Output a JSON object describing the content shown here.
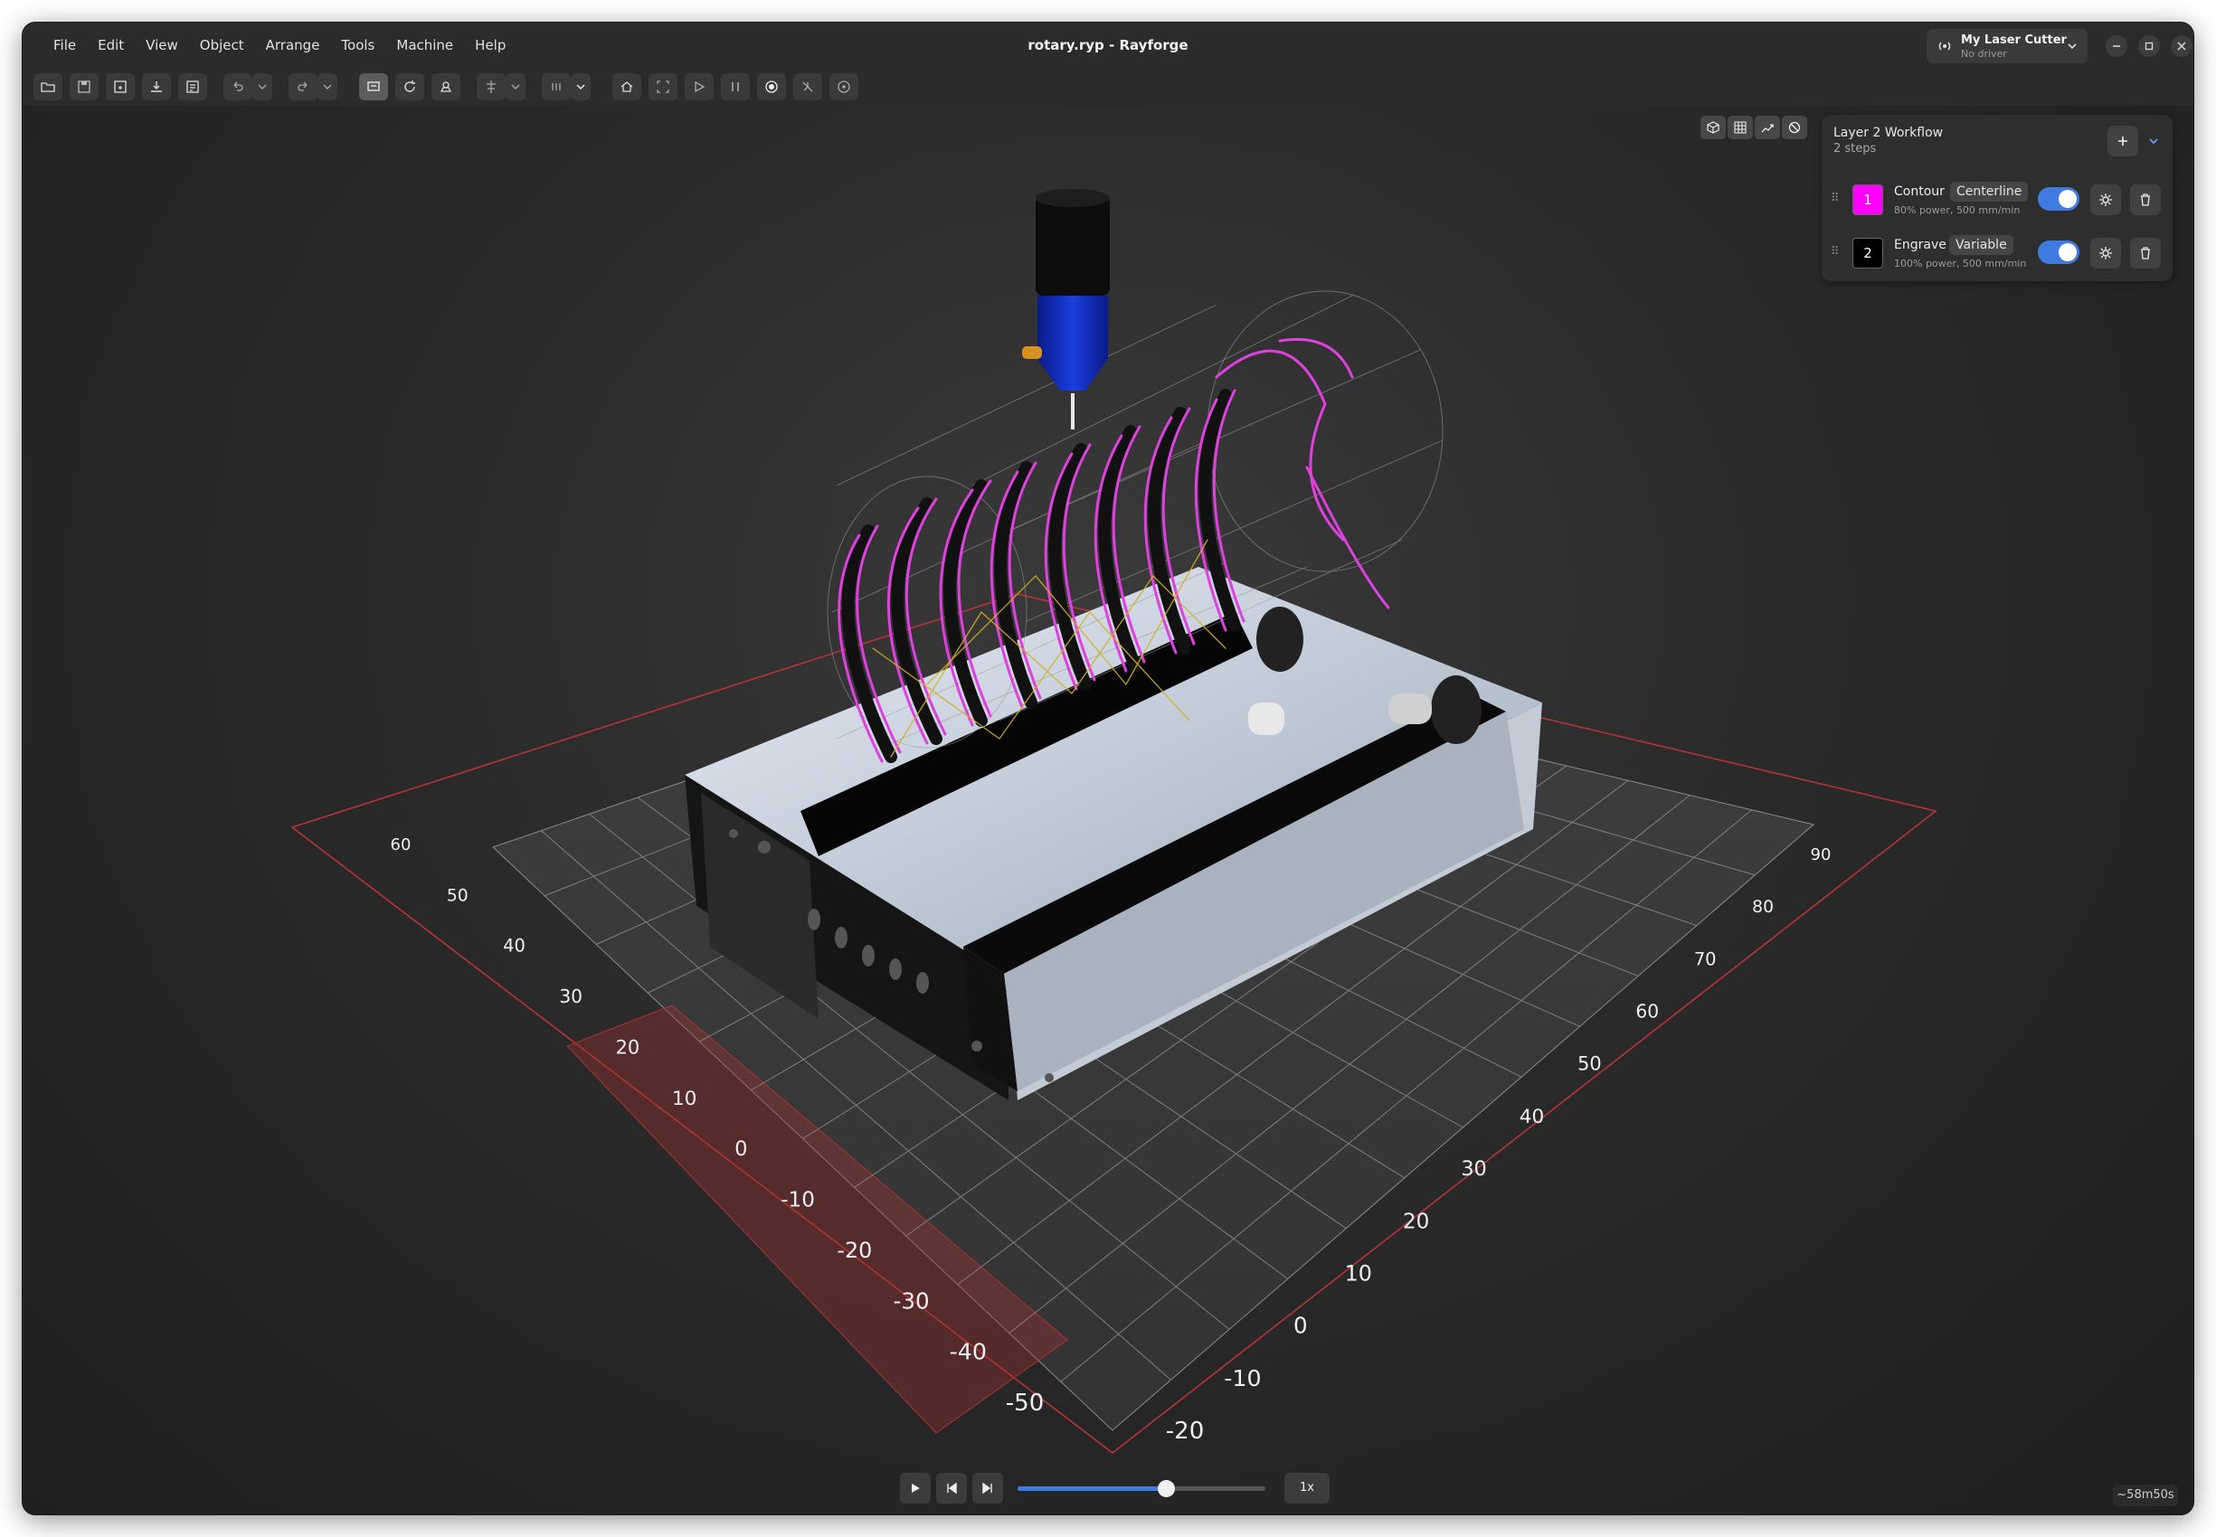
{
  "window": {
    "title": "rotary.ryp - Rayforge"
  },
  "menu": [
    "File",
    "Edit",
    "View",
    "Object",
    "Arrange",
    "Tools",
    "Machine",
    "Help"
  ],
  "machine": {
    "name": "My Laser Cutter",
    "status": "No driver"
  },
  "workflow": {
    "title": "Layer 2 Workflow",
    "subtitle": "2 steps",
    "steps": [
      {
        "number": "1",
        "name": "Contour",
        "mode": "Centerline",
        "details": "80% power, 500 mm/min",
        "color": "#ff00ff",
        "enabled": true
      },
      {
        "number": "2",
        "name": "Engrave",
        "mode": "Variable",
        "details": "100% power, 500 mm/min",
        "color": "#000000",
        "enabled": true
      }
    ]
  },
  "axes": {
    "left_labels": [
      "60",
      "50",
      "40",
      "30",
      "20",
      "10",
      "0",
      "-10",
      "-20",
      "-30",
      "-40",
      "-50"
    ],
    "right_labels": [
      "90",
      "80",
      "70",
      "60",
      "50",
      "40",
      "30",
      "20",
      "10",
      "0",
      "-10",
      "-20"
    ]
  },
  "playback": {
    "speed": "1x",
    "progress": 0.6,
    "remaining": "~58m50s"
  },
  "colors": {
    "accent": "#3f7be0",
    "toolpath": "#e040e0",
    "travel": "#d4b020",
    "bounds": "#cc3333"
  }
}
